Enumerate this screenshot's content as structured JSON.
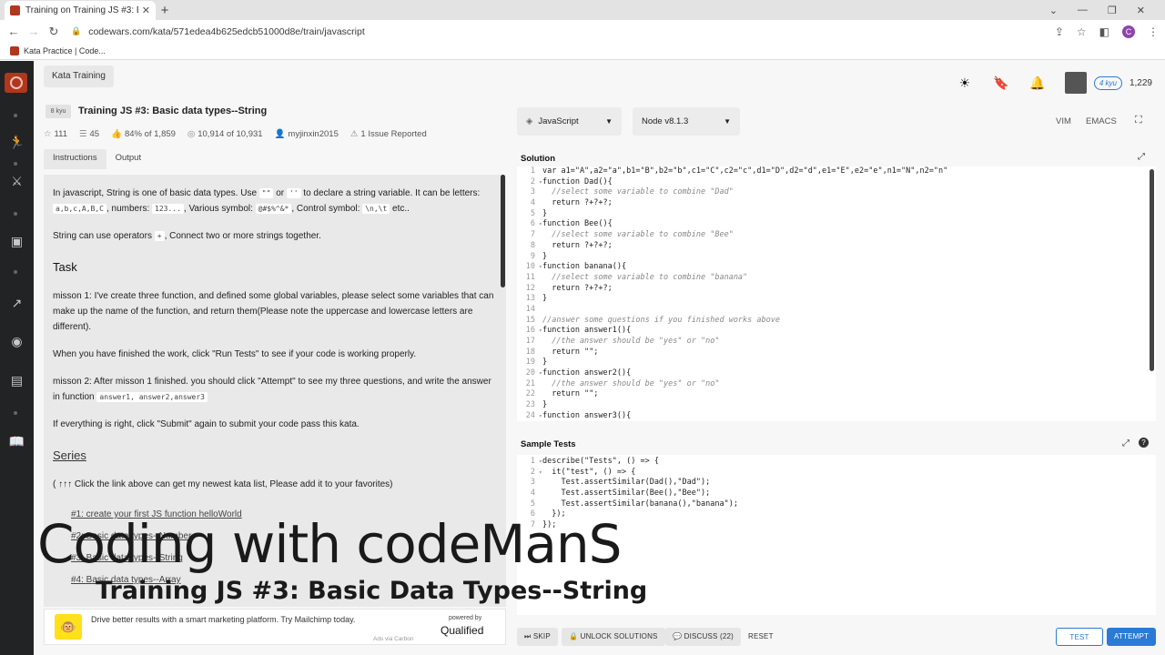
{
  "browser": {
    "tab_title": "Training on Training JS #3: Basic",
    "url": "codewars.com/kata/571edea4b625edcb51000d8e/train/javascript",
    "bookmark": "Kata Practice | Code..."
  },
  "header": {
    "kata_training": "Kata Training",
    "rank": "4 kyu",
    "honor": "1,229"
  },
  "kata": {
    "kyu": "8 kyu",
    "title": "Training JS #3: Basic data types--String",
    "stats": {
      "stars": "111",
      "collections": "45",
      "satisfaction": "84% of 1,859",
      "completed": "10,914 of 10,931",
      "author": "myjinxin2015",
      "issues": "1 Issue Reported"
    }
  },
  "left_tabs": [
    "Instructions",
    "Output"
  ],
  "instructions": {
    "p1_a": "In javascript, String is one of basic data types. Use ",
    "p1_code1": "\"\"",
    "p1_b": " or ",
    "p1_code2": "''",
    "p1_c": " to declare a string variable. It can be letters: ",
    "p1_code3": "a,b,c,A,B,C",
    "p1_d": ", numbers: ",
    "p1_code4": "123...",
    "p1_e": ", Various symbol: ",
    "p1_code5": "@#$%^&*",
    "p1_f": ", Control symbol: ",
    "p1_code6": "\\n,\\t",
    "p1_g": " etc..",
    "p2_a": "String can use operators ",
    "p2_code": "+",
    "p2_b": ", Connect two or more strings together.",
    "task_heading": "Task",
    "p3": "misson 1: I've create three function, and defined some global variables, please select some variables that can make up the name of the function, and return them(Please note the uppercase and lowercase letters are different).",
    "p4": "When you have finished the work, click \"Run Tests\" to see if your code is working properly.",
    "p5_a": "misson 2: After misson 1 finished. you should click \"Attempt\" to see my three questions, and write the answer in function ",
    "p5_code": "answer1, answer2,answer3",
    "p6": "If everything is right, click \"Submit\" again to submit your code pass this kata.",
    "series_heading": "Series",
    "p7": "( ↑↑↑ Click the link above can get my newest kata list, Please add it to your favorites)",
    "series_links": [
      "#1: create your first JS function helloWorld",
      "#2: Basic data types--Number",
      "#3: Basic data types--String",
      "#4: Basic data types--Array"
    ]
  },
  "ad": {
    "text": "Drive better results with a smart marketing platform. Try Mailchimp today.",
    "via": "Ads via Carbon",
    "powered_by": "powered by",
    "brand": "Qualified"
  },
  "editor": {
    "language": "JavaScript",
    "runtime": "Node v8.1.3",
    "vim": "VIM",
    "emacs": "EMACS",
    "solution_label": "Solution",
    "sample_tests_label": "Sample Tests"
  },
  "solution_code": [
    "var a1=\"A\",a2=\"a\",b1=\"B\",b2=\"b\",c1=\"C\",c2=\"c\",d1=\"D\",d2=\"d\",e1=\"E\",e2=\"e\",n1=\"N\",n2=\"n\"",
    "function Dad(){",
    "  //select some variable to combine \"Dad\"",
    "  return ?+?+?;",
    "}",
    "function Bee(){",
    "  //select some variable to combine \"Bee\"",
    "  return ?+?+?;",
    "}",
    "function banana(){",
    "  //select some variable to combine \"banana\"",
    "  return ?+?+?;",
    "}",
    "",
    "//answer some questions if you finished works above",
    "function answer1(){",
    "  //the answer should be \"yes\" or \"no\"",
    "  return \"\";",
    "}",
    "function answer2(){",
    "  //the answer should be \"yes\" or \"no\"",
    "  return \"\";",
    "}",
    "function answer3(){"
  ],
  "test_code": [
    "describe(\"Tests\", () => {",
    "  it(\"test\", () => {",
    "    Test.assertSimilar(Dad(),\"Dad\");",
    "    Test.assertSimilar(Bee(),\"Bee\");",
    "    Test.assertSimilar(banana(),\"banana\");",
    "  });",
    "});"
  ],
  "buttons": {
    "skip": "SKIP",
    "unlock": "UNLOCK SOLUTIONS",
    "discuss": "DISCUSS (22)",
    "reset": "RESET",
    "test": "TEST",
    "attempt": "ATTEMPT"
  },
  "overlay": {
    "title": "Coding with codeManS",
    "subtitle": "Training JS #3: Basic Data Types--String"
  },
  "colors": {
    "brand": "#b1361e",
    "accent": "#2a7bd6",
    "sidebar": "#222325"
  }
}
